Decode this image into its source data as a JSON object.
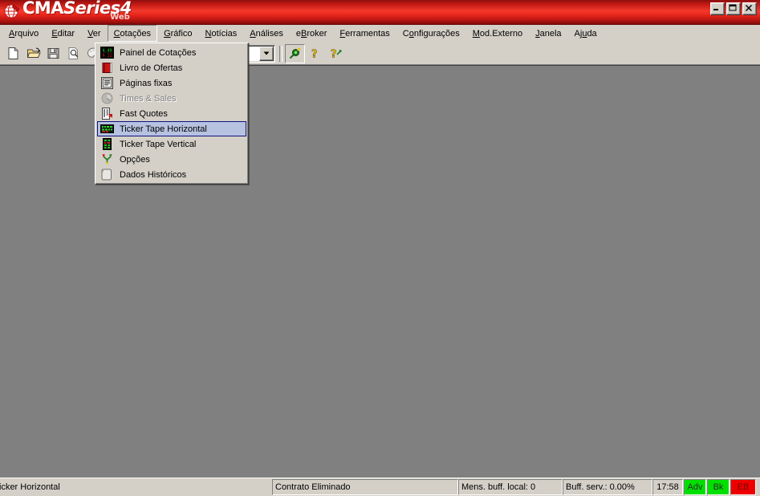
{
  "titlebar": {
    "logo_cma": "CMA",
    "logo_series": "Series4",
    "logo_sub": "Web",
    "logo_icon": "cma-globe-logo-icon",
    "buttons": [
      {
        "name": "minimize-button",
        "icon": "minimize-icon"
      },
      {
        "name": "maximize-button",
        "icon": "maximize-icon"
      },
      {
        "name": "close-button",
        "icon": "close-icon"
      }
    ]
  },
  "menubar": {
    "items": [
      {
        "label": "Arquivo",
        "accel": "A",
        "open": false
      },
      {
        "label": "Editar",
        "accel": "E",
        "open": false
      },
      {
        "label": "Ver",
        "accel": "V",
        "open": false
      },
      {
        "label": "Cotações",
        "accel": "C",
        "open": true
      },
      {
        "label": "Gráfico",
        "accel": "G",
        "open": false
      },
      {
        "label": "Notícias",
        "accel": "N",
        "open": false
      },
      {
        "label": "Análises",
        "accel": "A",
        "open": false
      },
      {
        "label": "eBroker",
        "accel": "B",
        "open": false
      },
      {
        "label": "Ferramentas",
        "accel": "F",
        "open": false
      },
      {
        "label": "Configurações",
        "accel": "o",
        "open": false
      },
      {
        "label": "Mod.Externo",
        "accel": "M",
        "open": false
      },
      {
        "label": "Janela",
        "accel": "J",
        "open": false
      },
      {
        "label": "Ajuda",
        "accel": "u",
        "open": false
      }
    ]
  },
  "toolbar": {
    "buttons": [
      {
        "name": "new-document-button",
        "icon": "new-document-icon"
      },
      {
        "name": "open-folder-button",
        "icon": "open-folder-icon"
      },
      {
        "name": "save-button",
        "icon": "save-disk-icon"
      },
      {
        "name": "print-preview-button",
        "icon": "print-preview-icon"
      },
      {
        "name": "palette-button",
        "icon": "palette-icon"
      }
    ],
    "combo_value": "",
    "combo_arrow_icon": "chevron-down-icon",
    "right_buttons": [
      {
        "name": "connection-plug-button",
        "icon": "plug-connector-icon"
      },
      {
        "name": "help-button",
        "icon": "question-mark-icon"
      },
      {
        "name": "context-help-button",
        "icon": "question-mark-arrow-icon"
      }
    ]
  },
  "dropdown": {
    "owner": "Cotações",
    "items": [
      {
        "label": "Painel de Cotações",
        "icon": "quote-panel-icon",
        "disabled": false,
        "selected": false
      },
      {
        "label": "Livro de Ofertas",
        "icon": "order-book-icon",
        "disabled": false,
        "selected": false
      },
      {
        "label": "Páginas fixas",
        "icon": "fixed-pages-icon",
        "disabled": false,
        "selected": false
      },
      {
        "label": "Times & Sales",
        "icon": "times-sales-icon",
        "disabled": true,
        "selected": false
      },
      {
        "label": "Fast Quotes",
        "icon": "fast-quotes-icon",
        "disabled": false,
        "selected": false
      },
      {
        "label": "Ticker Tape Horizontal",
        "icon": "ticker-horizontal-icon",
        "disabled": false,
        "selected": true
      },
      {
        "label": "Ticker Tape Vertical",
        "icon": "ticker-vertical-icon",
        "disabled": false,
        "selected": false
      },
      {
        "label": "Opções",
        "icon": "options-branch-icon",
        "disabled": false,
        "selected": false
      },
      {
        "label": "Dados Históricos",
        "icon": "historic-data-icon",
        "disabled": false,
        "selected": false
      }
    ]
  },
  "statusbar": {
    "main_text": "icker Horizontal",
    "contract": "Contrato Eliminado",
    "mens_buff": "Mens. buff. local: 0",
    "buff_serv": "Buff. serv.: 0.00%",
    "time": "17:58",
    "badges": [
      {
        "label": "Adv",
        "color": "#00e000"
      },
      {
        "label": "Bk",
        "color": "#00e000"
      },
      {
        "label": "EB",
        "color": "#ef0000"
      }
    ]
  },
  "colors": {
    "titlebar_red": "#ee2a1e",
    "chrome": "#d4d0c8",
    "client_gray": "#808080",
    "menu_highlight": "#b6c2e0",
    "menu_highlight_border": "#10137c",
    "badge_green": "#00e000",
    "badge_red": "#ef0000"
  }
}
